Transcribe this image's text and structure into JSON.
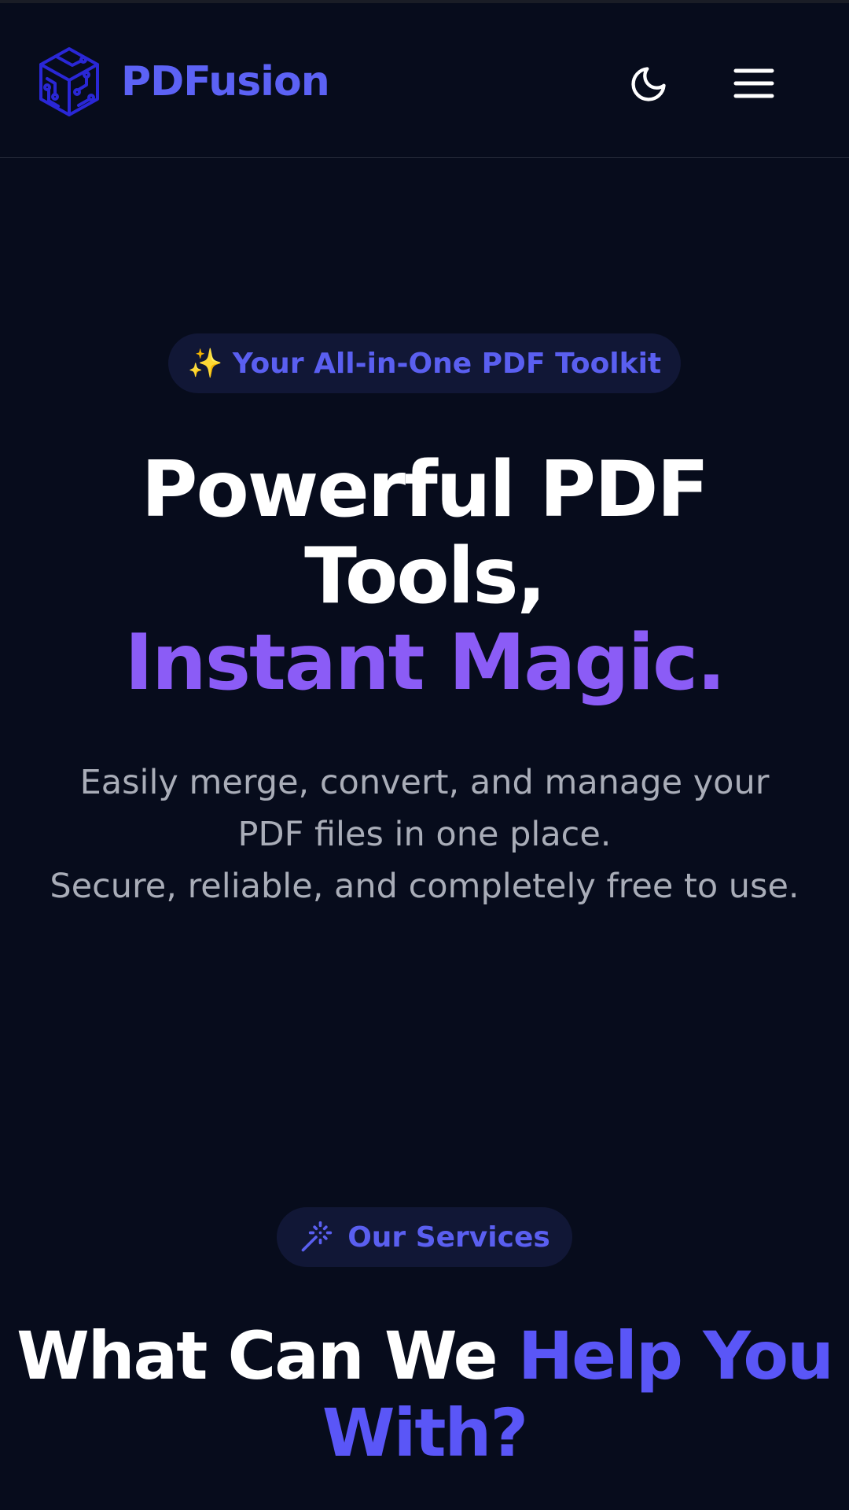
{
  "header": {
    "brand": "PDFusion",
    "logo_icon": "circuit-cube-icon",
    "theme_toggle_icon": "moon-icon",
    "menu_icon": "hamburger-menu-icon"
  },
  "hero": {
    "badge_emoji": "✨",
    "badge_text": "Your All-in-One PDF Toolkit",
    "title_line1": "Powerful PDF",
    "title_line2": "Tools,",
    "title_accent": "Instant Magic.",
    "description_line1": "Easily merge, convert, and manage your PDF files in one place.",
    "description_line2": "Secure, reliable, and completely free to use."
  },
  "services": {
    "badge_icon": "magic-wand-icon",
    "badge_text": "Our Services",
    "heading_plain": "What Can We ",
    "heading_accent": "Help You With?"
  },
  "colors": {
    "background": "#070c1c",
    "brand": "#5c62f5",
    "accent_purple": "#8b5cf6",
    "accent_indigo": "#5a56f7",
    "pill_bg": "#111736",
    "muted_text": "#a9adb8"
  }
}
